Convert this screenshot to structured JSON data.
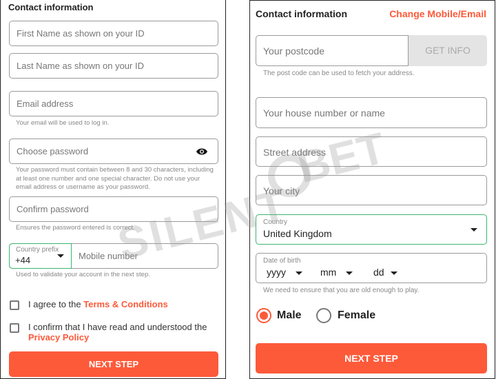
{
  "watermark": "SILENTBET",
  "colors": {
    "accent": "#fd5a3a",
    "focus": "#3cb371"
  },
  "left": {
    "title": "Contact information",
    "first_name_placeholder": "First Name as shown on your ID",
    "last_name_placeholder": "Last Name as shown on your ID",
    "email_placeholder": "Email address",
    "email_help": "Your email will be used to log in.",
    "password_placeholder": "Choose password",
    "password_icon": "eye-icon",
    "password_help": "Your password must contain between 8 and 30 characters, including at least one number and one special character. Do not use your email address or username as your password.",
    "confirm_placeholder": "Confirm password",
    "confirm_help": "Ensures the password entered is correct.",
    "prefix_label": "Country prefix",
    "prefix_value": "+44",
    "mobile_placeholder": "Mobile number",
    "mobile_help": "Used to validate your account in the next step.",
    "terms_text": "I agree to the ",
    "terms_link": "Terms & Conditions",
    "privacy_text": "I confirm that I have read and understood the ",
    "privacy_link": "Privacy Policy",
    "next_label": "NEXT STEP"
  },
  "right": {
    "title": "Contact information",
    "change_link": "Change Mobile/Email",
    "postcode_placeholder": "Your postcode",
    "get_info_label": "GET INFO",
    "postcode_help": "The post code can be used to fetch your address.",
    "house_placeholder": "Your house number or name",
    "street_placeholder": "Street address",
    "city_placeholder": "Your city",
    "country_label": "Country",
    "country_value": "United Kingdom",
    "dob_label": "Date of birth",
    "dob_year": "yyyy",
    "dob_month": "mm",
    "dob_day": "dd",
    "dob_help": "We need to ensure that you are old enough to play.",
    "gender_male": "Male",
    "gender_female": "Female",
    "gender_selected": "Male",
    "next_label": "NEXT STEP"
  }
}
